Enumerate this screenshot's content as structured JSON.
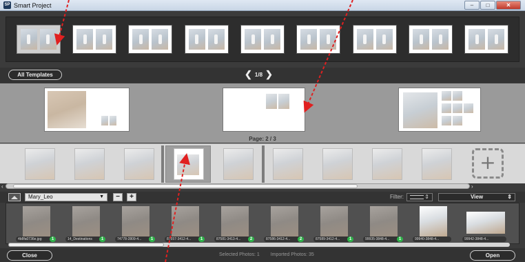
{
  "window": {
    "title": "Smart Project",
    "minimize": "–",
    "maximize": "□",
    "close": "✕"
  },
  "toolbar": {
    "all_templates": "All Templates",
    "page_indicator": "1/8",
    "prev": "❮",
    "next": "❯"
  },
  "spreads": {
    "page_label": "Page: 2 / 3"
  },
  "pages": {
    "add_label": "+"
  },
  "library": {
    "folder": "Mary_Leo",
    "remove": "−",
    "add": "+",
    "filter_label": "Filter:",
    "view_label": "View",
    "photos": [
      {
        "name": "4b8fa0736e.jpg",
        "count": "1"
      },
      {
        "name": "14_Destinations",
        "count": "1"
      },
      {
        "name": "74778-2809-4...",
        "count": "1"
      },
      {
        "name": "87557-3412-4...",
        "count": "1"
      },
      {
        "name": "87581-3413-4...",
        "count": "2"
      },
      {
        "name": "87586-3412-4...",
        "count": "2"
      },
      {
        "name": "87589-3412-4...",
        "count": "1"
      },
      {
        "name": "99935-3848-4...",
        "count": "1"
      },
      {
        "name": "99940-3848-4...",
        "count": ""
      },
      {
        "name": "99942-3848-4...",
        "count": ""
      }
    ]
  },
  "footer": {
    "close": "Close",
    "open": "Open",
    "selected": "Selected Photos: 1",
    "imported": "Imported Photos: 35"
  },
  "colors": {
    "accent_red": "#e02020",
    "badge_green": "#2fb34a"
  }
}
